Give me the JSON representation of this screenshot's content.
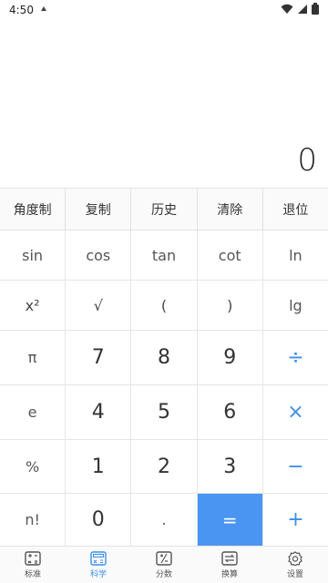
{
  "status": {
    "time": "4:50"
  },
  "display": {
    "value": "0"
  },
  "function_row": [
    "角度制",
    "复制",
    "历史",
    "清除",
    "退位"
  ],
  "keypad": [
    [
      "sin",
      "cos",
      "tan",
      "cot",
      "ln"
    ],
    [
      "x²",
      "√",
      "(",
      ")",
      "lg"
    ],
    [
      "π",
      "7",
      "8",
      "9",
      "÷"
    ],
    [
      "e",
      "4",
      "5",
      "6",
      "×"
    ],
    [
      "%",
      "1",
      "2",
      "3",
      "−"
    ],
    [
      "n!",
      "0",
      ".",
      "=",
      "+"
    ]
  ],
  "tabs": [
    {
      "label": "标准",
      "icon": "standard-calculator-icon"
    },
    {
      "label": "科学",
      "icon": "scientific-calculator-icon"
    },
    {
      "label": "分数",
      "icon": "fraction-icon"
    },
    {
      "label": "换算",
      "icon": "conversion-icon"
    },
    {
      "label": "设置",
      "icon": "settings-gear-icon"
    }
  ],
  "active_tab": "科学",
  "colors": {
    "accent": "#3c8fe8",
    "equals_bg": "#4b95f2"
  }
}
